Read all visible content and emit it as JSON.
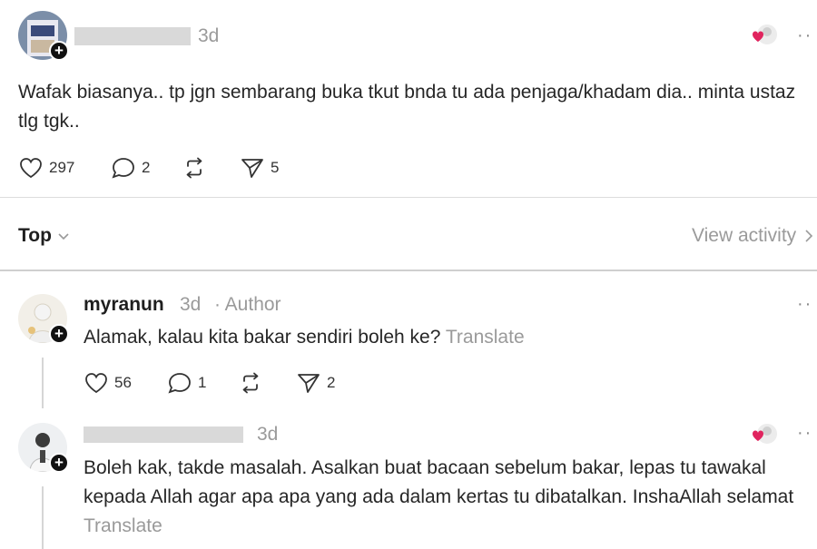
{
  "post": {
    "username_redacted": "",
    "time": "3d",
    "text": "Wafak biasanya.. tp jgn sembarang buka tkut bnda tu ada penjaga/khadam dia.. minta ustaz tlg tgk..",
    "more_icon": "more-horizontal-icon",
    "likes": "297",
    "replies": "2",
    "reposts": "",
    "shares": "5"
  },
  "sort": {
    "label": "Top",
    "view_activity": "View activity"
  },
  "comments": [
    {
      "username": "myranun",
      "time": "3d",
      "author_tag": "· Author",
      "text": "Alamak, kalau kita bakar sendiri boleh ke?",
      "translate": "Translate",
      "likes": "56",
      "replies": "1",
      "shares": "2"
    },
    {
      "username_redacted": "",
      "time": "3d",
      "text": "Boleh kak, takde masalah. Asalkan buat bacaan sebelum bakar, lepas tu tawakal kepada Allah agar apa apa yang ada dalam kertas tu dibatalkan. InshaAllah selamat",
      "translate": "Translate"
    }
  ],
  "colors": {
    "heart_red": "#e0245e",
    "muted": "#9a9a9a",
    "divider": "#dcdcdc"
  }
}
